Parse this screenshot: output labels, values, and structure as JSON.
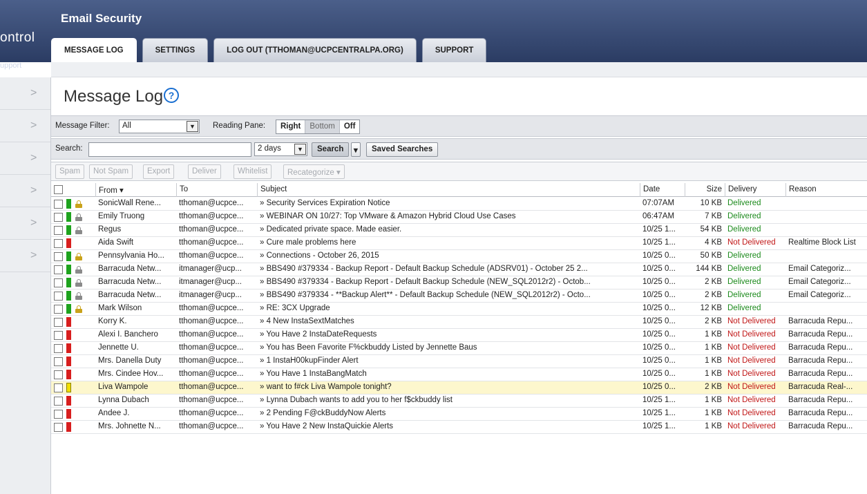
{
  "app": {
    "title": "Email Security",
    "brand_partial": "ontrol",
    "brand_sub": "upport"
  },
  "tabs": [
    {
      "label": "MESSAGE LOG",
      "active": true
    },
    {
      "label": "SETTINGS",
      "active": false
    },
    {
      "label": "LOG OUT (TTHOMAN@UCPCENTRALPA.ORG)",
      "active": false
    },
    {
      "label": "SUPPORT",
      "active": false
    }
  ],
  "page": {
    "title": "Message Log",
    "help_icon": "question-circle-icon",
    "help_glyph": "?"
  },
  "filter": {
    "label": "Message Filter:",
    "value": "All",
    "reading_pane_label": "Reading Pane:",
    "reading_pane_options": [
      "Right",
      "Bottom",
      "Off"
    ],
    "reading_pane_selected": "Bottom"
  },
  "search": {
    "label": "Search:",
    "value": "",
    "range": "2 days",
    "search_button": "Search",
    "saved_searches_button": "Saved Searches"
  },
  "actions": {
    "spam": "Spam",
    "not_spam": "Not Spam",
    "export": "Export",
    "deliver": "Deliver",
    "whitelist": "Whitelist",
    "recategorize": "Recategorize ▾"
  },
  "columns": {
    "from": "From ▾",
    "to": "To",
    "subject": "Subject",
    "date": "Date",
    "size": "Size",
    "delivery": "Delivery",
    "reason": "Reason"
  },
  "colors": {
    "flag_green": "#1ea31e",
    "flag_red": "#d81e1e",
    "flag_yellow": "#f2e000",
    "lock_gold": "#c9a21a",
    "lock_gray": "#8a8a8a",
    "delivered": "#1c8a1c",
    "not_delivered": "#c01515"
  },
  "messages": [
    {
      "from": "SonicWall Rene...",
      "to": "tthoman@ucpce...",
      "subject": "» Security Services Expiration Notice",
      "date": "07:07AM",
      "size": "10 KB",
      "delivery": "Delivered",
      "reason": "",
      "flag": "green",
      "lock": "gold"
    },
    {
      "from": "Emily Truong",
      "to": "tthoman@ucpce...",
      "subject": "» WEBINAR ON 10/27: Top VMware & Amazon Hybrid Cloud Use Cases",
      "date": "06:47AM",
      "size": "7 KB",
      "delivery": "Delivered",
      "reason": "",
      "flag": "green",
      "lock": "gray"
    },
    {
      "from": "Regus",
      "to": "tthoman@ucpce...",
      "subject": "» Dedicated private space. Made easier.",
      "date": "10/25 1...",
      "size": "54 KB",
      "delivery": "Delivered",
      "reason": "",
      "flag": "green",
      "lock": "gray"
    },
    {
      "from": "Aida Swift",
      "to": "tthoman@ucpce...",
      "subject": "» Cure male problems here",
      "date": "10/25 1...",
      "size": "4 KB",
      "delivery": "Not Delivered",
      "reason": "Realtime Block List",
      "flag": "red",
      "lock": ""
    },
    {
      "from": "Pennsylvania Ho...",
      "to": "tthoman@ucpce...",
      "subject": "» Connections - October 26, 2015",
      "date": "10/25 0...",
      "size": "50 KB",
      "delivery": "Delivered",
      "reason": "",
      "flag": "green",
      "lock": "gold"
    },
    {
      "from": "Barracuda Netw...",
      "to": "itmanager@ucp...",
      "subject": "» BBS490 #379334 - Backup Report - Default Backup Schedule (ADSRV01) - October 25 2...",
      "date": "10/25 0...",
      "size": "144 KB",
      "delivery": "Delivered",
      "reason": "Email Categoriz...",
      "flag": "green",
      "lock": "gray"
    },
    {
      "from": "Barracuda Netw...",
      "to": "itmanager@ucp...",
      "subject": "» BBS490 #379334 - Backup Report - Default Backup Schedule (NEW_SQL2012r2) - Octob...",
      "date": "10/25 0...",
      "size": "2 KB",
      "delivery": "Delivered",
      "reason": "Email Categoriz...",
      "flag": "green",
      "lock": "gray"
    },
    {
      "from": "Barracuda Netw...",
      "to": "itmanager@ucp...",
      "subject": "» BBS490 #379334 - **Backup Alert** - Default Backup Schedule (NEW_SQL2012r2) - Octo...",
      "date": "10/25 0...",
      "size": "2 KB",
      "delivery": "Delivered",
      "reason": "Email Categoriz...",
      "flag": "green",
      "lock": "gray"
    },
    {
      "from": "Mark Wilson",
      "to": "tthoman@ucpce...",
      "subject": "» RE: 3CX Upgrade",
      "date": "10/25 0...",
      "size": "12 KB",
      "delivery": "Delivered",
      "reason": "",
      "flag": "green",
      "lock": "gold"
    },
    {
      "from": "Korry K.",
      "to": "tthoman@ucpce...",
      "subject": "» 4 New InstaSextMatches",
      "date": "10/25 0...",
      "size": "2 KB",
      "delivery": "Not Delivered",
      "reason": "Barracuda Repu...",
      "flag": "red",
      "lock": ""
    },
    {
      "from": "Alexi I. Banchero",
      "to": "tthoman@ucpce...",
      "subject": "» You Have 2 InstaDateRequests",
      "date": "10/25 0...",
      "size": "1 KB",
      "delivery": "Not Delivered",
      "reason": "Barracuda Repu...",
      "flag": "red",
      "lock": ""
    },
    {
      "from": "Jennette U.",
      "to": "tthoman@ucpce...",
      "subject": "» You has Been Favorite F%ckbuddy Listed by Jennette Baus",
      "date": "10/25 0...",
      "size": "1 KB",
      "delivery": "Not Delivered",
      "reason": "Barracuda Repu...",
      "flag": "red",
      "lock": ""
    },
    {
      "from": "Mrs. Danella Duty",
      "to": "tthoman@ucpce...",
      "subject": "» 1 InstaH00kupFinder Alert",
      "date": "10/25 0...",
      "size": "1 KB",
      "delivery": "Not Delivered",
      "reason": "Barracuda Repu...",
      "flag": "red",
      "lock": ""
    },
    {
      "from": "Mrs. Cindee Hov...",
      "to": "tthoman@ucpce...",
      "subject": "» You Have 1 InstaBangMatch",
      "date": "10/25 0...",
      "size": "1 KB",
      "delivery": "Not Delivered",
      "reason": "Barracuda Repu...",
      "flag": "red",
      "lock": ""
    },
    {
      "from": "Liva Wampole",
      "to": "tthoman@ucpce...",
      "subject": "» want to f#ck Liva Wampole tonight?",
      "date": "10/25 0...",
      "size": "2 KB",
      "delivery": "Not Delivered",
      "reason": "Barracuda Real-...",
      "flag": "yellow",
      "lock": "",
      "highlight": true
    },
    {
      "from": "Lynna Dubach",
      "to": "tthoman@ucpce...",
      "subject": "» Lynna Dubach wants to add you to her f$ckbuddy list",
      "date": "10/25 1...",
      "size": "1 KB",
      "delivery": "Not Delivered",
      "reason": "Barracuda Repu...",
      "flag": "red",
      "lock": ""
    },
    {
      "from": "Andee J.",
      "to": "tthoman@ucpce...",
      "subject": "» 2 Pending F@ckBuddyNow Alerts",
      "date": "10/25 1...",
      "size": "1 KB",
      "delivery": "Not Delivered",
      "reason": "Barracuda Repu...",
      "flag": "red",
      "lock": ""
    },
    {
      "from": "Mrs. Johnette N...",
      "to": "tthoman@ucpce...",
      "subject": "» You Have 2 New InstaQuickie Alerts",
      "date": "10/25 1...",
      "size": "1 KB",
      "delivery": "Not Delivered",
      "reason": "Barracuda Repu...",
      "flag": "red",
      "lock": ""
    }
  ],
  "leftnav": [
    ">",
    ">",
    ">",
    ">",
    ">",
    ">"
  ]
}
